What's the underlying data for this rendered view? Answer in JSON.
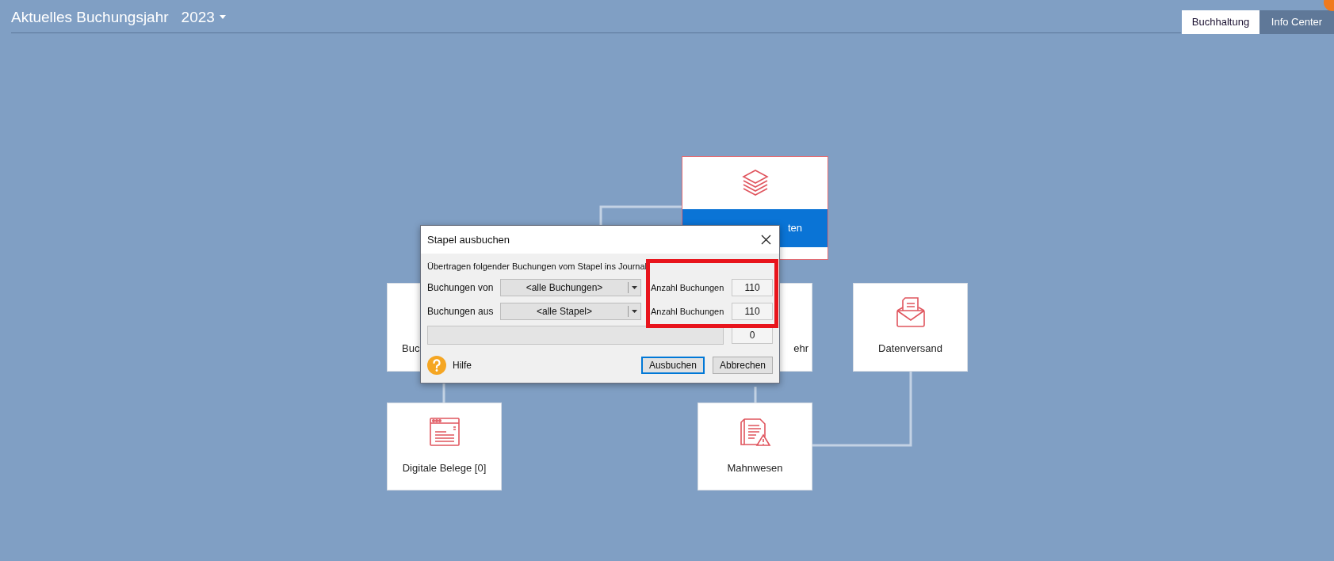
{
  "header": {
    "title": "Aktuelles Buchungsjahr",
    "year": "2023"
  },
  "tabs": [
    {
      "label": "Buchhaltung",
      "selected": true
    },
    {
      "label": "Info Center",
      "selected": false
    }
  ],
  "tiles": [
    {
      "label": "ten",
      "kind": "highlighted"
    },
    {
      "label": "Buc",
      "kind": "plain"
    },
    {
      "label": "ehr",
      "kind": "plain"
    },
    {
      "label": "Datenversand",
      "kind": "plain"
    },
    {
      "label": "Digitale Belege [0]",
      "kind": "plain"
    },
    {
      "label": "Mahnwesen",
      "kind": "plain"
    }
  ],
  "dialog": {
    "title": "Stapel ausbuchen",
    "intro": "Übertragen folgender Buchungen vom Stapel ins Journal",
    "rows": [
      {
        "label": "Buchungen von",
        "value": "<alle Buchungen>",
        "count_label": "Anzahl Buchungen",
        "count": "110"
      },
      {
        "label": "Buchungen aus",
        "value": "<alle Stapel>",
        "count_label": "Anzahl Buchungen",
        "count": "110"
      }
    ],
    "progress": {
      "level": 0,
      "count": "0"
    },
    "help": "Hilfe",
    "buttons": [
      {
        "label": "Ausbuchen",
        "default": true
      },
      {
        "label": "Abbrechen",
        "default": false
      }
    ]
  }
}
